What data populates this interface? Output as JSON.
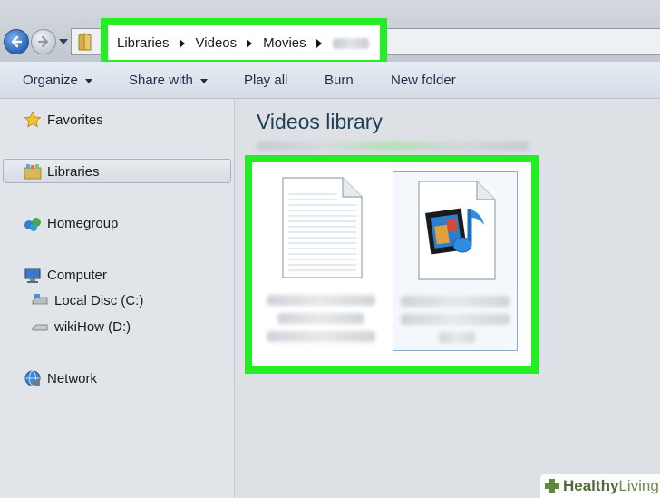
{
  "address_bar": {
    "breadcrumbs": [
      "Libraries",
      "Videos",
      "Movies"
    ]
  },
  "toolbar": {
    "organize_label": "Organize",
    "share_with_label": "Share with",
    "play_all_label": "Play all",
    "burn_label": "Burn",
    "new_folder_label": "New folder"
  },
  "sidebar": {
    "favorites": "Favorites",
    "libraries": "Libraries",
    "homegroup": "Homegroup",
    "computer": "Computer",
    "local_disc": "Local Disc (C:)",
    "wikihow_drive": "wikiHow (D:)",
    "network": "Network"
  },
  "content": {
    "library_title": "Videos library"
  },
  "watermark": {
    "brand_bold": "Healthy",
    "brand_light": "Living"
  },
  "colors": {
    "highlight": "#22ee22",
    "title_text": "#1e3f56"
  }
}
